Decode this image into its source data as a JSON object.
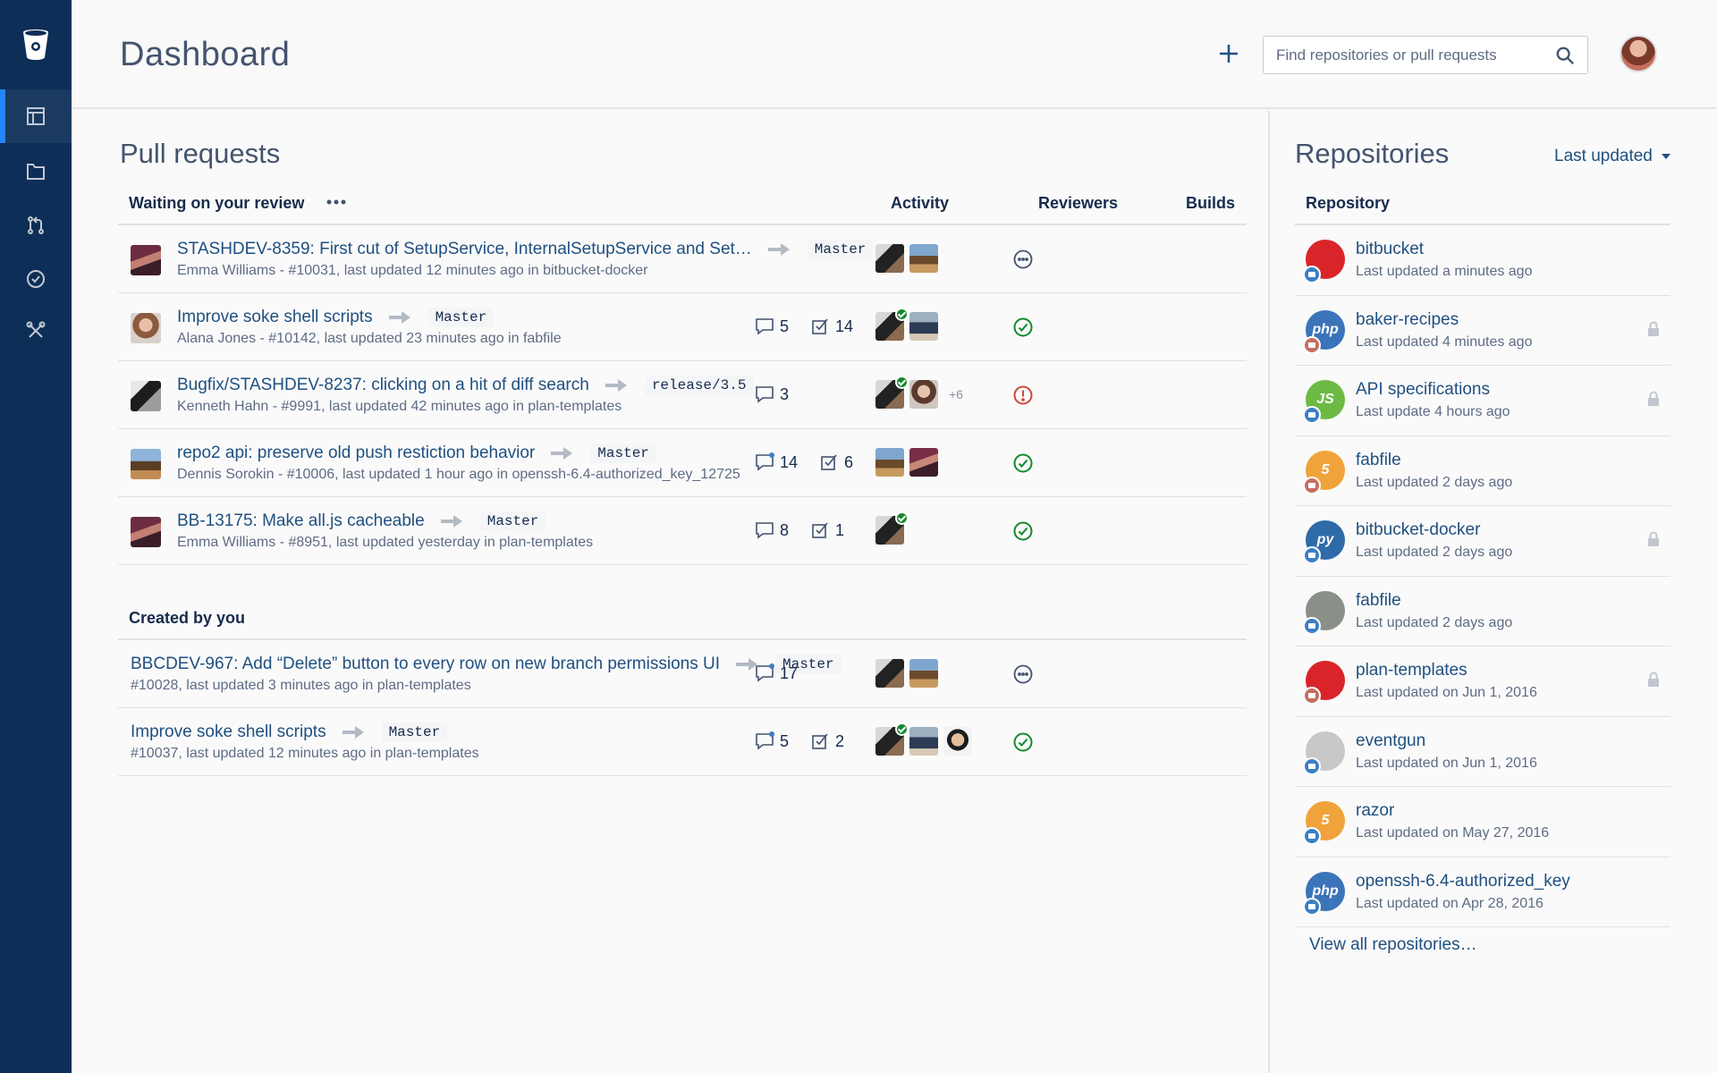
{
  "nav": {
    "items": [
      {
        "name": "dashboard",
        "icon": "dashboard-icon",
        "active": true
      },
      {
        "name": "repositories",
        "icon": "folder-icon",
        "active": false
      },
      {
        "name": "pull-requests",
        "icon": "pull-request-icon",
        "active": false
      },
      {
        "name": "tasks",
        "icon": "check-circle-icon",
        "active": false
      },
      {
        "name": "tools",
        "icon": "tools-icon",
        "active": false
      }
    ]
  },
  "header": {
    "title": "Dashboard",
    "search_placeholder": "Find repositories or pull requests"
  },
  "pull_requests": {
    "title": "Pull requests",
    "columns": {
      "activity": "Activity",
      "reviewers": "Reviewers",
      "builds": "Builds"
    },
    "waiting": {
      "label": "Waiting on your review",
      "rows": [
        {
          "title": "STASHDEV-8359: First cut of SetupService, InternalSetupService and Set…",
          "branch": "Master",
          "meta": "Emma Williams - #10031, last updated 12 minutes ago in bitbucket-docker",
          "comments": "",
          "tasks": "",
          "build": "pending"
        },
        {
          "title": "Improve soke shell scripts",
          "branch": "Master",
          "meta": "Alana Jones - #10142, last updated 23 minutes ago in fabfile",
          "comments": "5",
          "tasks": "14",
          "build": "success"
        },
        {
          "title": "Bugfix/STASHDEV-8237: clicking on a hit of diff search",
          "branch": "release/3.5",
          "meta": "Kenneth Hahn - #9991, last updated 42 minutes ago in plan-templates",
          "comments": "3",
          "tasks": "",
          "build": "failed",
          "more_reviewers": "+6"
        },
        {
          "title": "repo2 api: preserve old push restiction behavior",
          "branch": "Master",
          "meta": "Dennis Sorokin - #10006, last updated 1 hour ago in openssh-6.4-authorized_key_12725",
          "comments": "14",
          "tasks": "6",
          "build": "success"
        },
        {
          "title": "BB-13175: Make all.js cacheable",
          "branch": "Master",
          "meta": "Emma Williams - #8951, last updated yesterday in plan-templates",
          "comments": "8",
          "tasks": "1",
          "build": "success"
        }
      ]
    },
    "created": {
      "label": "Created by you",
      "rows": [
        {
          "title": "BBCDEV-967: Add “Delete” button to every row on new branch permissions UI",
          "branch": "Master",
          "meta": "#10028, last updated 3 minutes ago in plan-templates",
          "comments": "17",
          "tasks": "",
          "build": "pending"
        },
        {
          "title": "Improve soke shell scripts",
          "branch": "Master",
          "meta": "#10037, last updated 12 minutes ago in plan-templates",
          "comments": "5",
          "tasks": "2",
          "build": "success"
        }
      ]
    }
  },
  "repositories": {
    "title": "Repositories",
    "sort_label": "Last updated",
    "column": "Repository",
    "items": [
      {
        "name": "bitbucket",
        "updated": "Last updated a minutes ago",
        "icon_color": "#d9252a",
        "icon_text": "",
        "locked": false
      },
      {
        "name": "baker-recipes",
        "updated": "Last updated 4 minutes ago",
        "icon_color": "#3b74b9",
        "icon_text": "php",
        "locked": true
      },
      {
        "name": "API specifications",
        "updated": "Last update 4 hours ago",
        "icon_color": "#6cba44",
        "icon_text": "JS",
        "locked": true
      },
      {
        "name": "fabfile",
        "updated": "Last updated 2 days ago",
        "icon_color": "#f0a33b",
        "icon_text": "5",
        "locked": false
      },
      {
        "name": "bitbucket-docker",
        "updated": "Last updated 2 days ago",
        "icon_color": "#2f6ba8",
        "icon_text": "py",
        "locked": true
      },
      {
        "name": "fabfile",
        "updated": "Last updated 2 days ago",
        "icon_color": "#8a8f87",
        "icon_text": "",
        "locked": false
      },
      {
        "name": "plan-templates",
        "updated": "Last updated on Jun 1, 2016",
        "icon_color": "#d9252a",
        "icon_text": "",
        "locked": true
      },
      {
        "name": "eventgun",
        "updated": "Last updated on Jun 1, 2016",
        "icon_color": "#c8c8c8",
        "icon_text": "",
        "locked": false
      },
      {
        "name": "razor",
        "updated": "Last updated on May 27, 2016",
        "icon_color": "#f0a33b",
        "icon_text": "5",
        "locked": false
      },
      {
        "name": "openssh-6.4-authorized_key",
        "updated": "Last updated on Apr 28, 2016",
        "icon_color": "#3b74b9",
        "icon_text": "php",
        "locked": false
      }
    ],
    "view_all": "View all repositories…"
  },
  "colors": {
    "nav_bg": "#0d2e57",
    "link": "#205081",
    "success": "#14892c",
    "error": "#d04437"
  }
}
